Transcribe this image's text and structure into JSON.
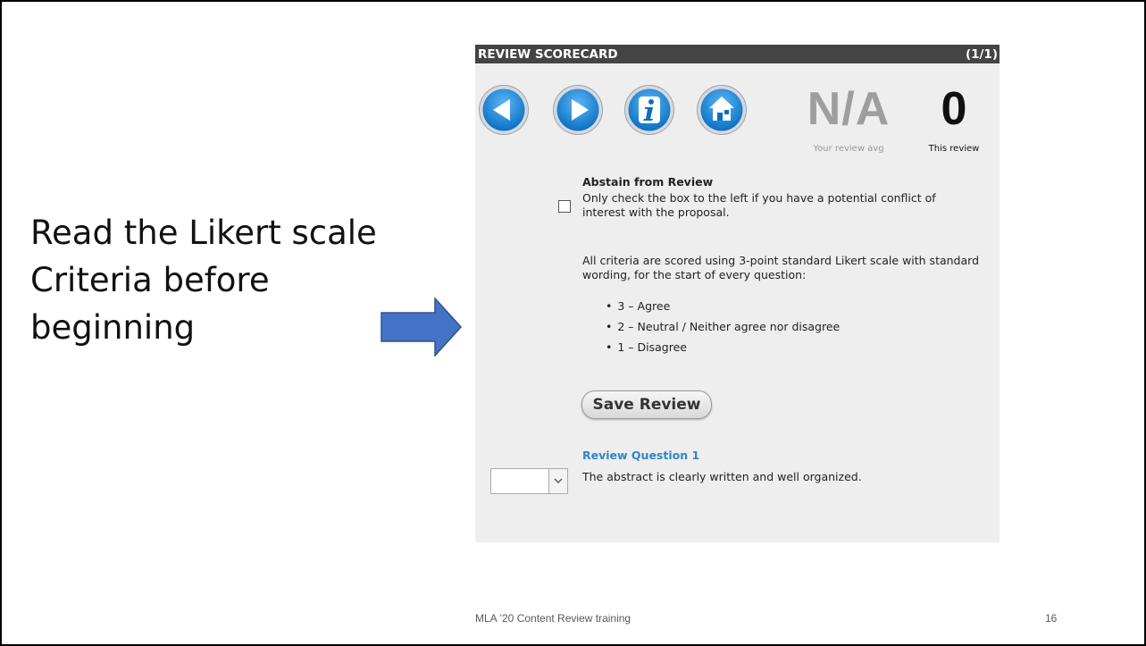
{
  "left_text": {
    "line1": "Read the Likert scale",
    "line2": "Criteria before",
    "line3": "beginning"
  },
  "scorecard": {
    "title": "REVIEW SCORECARD",
    "counter": "(1/1)",
    "nav_buttons": [
      "previous-icon",
      "next-icon",
      "info-icon",
      "home-icon"
    ],
    "your_review_avg_value": "N/A",
    "your_review_avg_caption": "Your review avg",
    "this_review_value": "0",
    "this_review_caption": "This review",
    "abstain_title": "Abstain from Review",
    "abstain_note": "Only check the box to the left if you have a potential conflict of interest with the proposal.",
    "abstain_checked": false,
    "criteria_intro": "All criteria are scored using 3-point standard Likert scale with standard wording, for the start of every question:",
    "likert_items": [
      "3 – Agree",
      "2 – Neutral / Neither agree nor disagree",
      "1 – Disagree"
    ],
    "save_button": "Save Review",
    "question_label": "Review Question 1",
    "question_text": "The abstract is clearly written and well organized.",
    "score_select_value": ""
  },
  "footer": {
    "text": "MLA ’20 Content Review training",
    "page": "16"
  },
  "colors": {
    "header_bg": "#444444",
    "panel_bg": "#eeeeee",
    "nav_button_blue": "#1e88d8",
    "question_label": "#2f86c9",
    "arrow_fill": "#4472c4"
  }
}
